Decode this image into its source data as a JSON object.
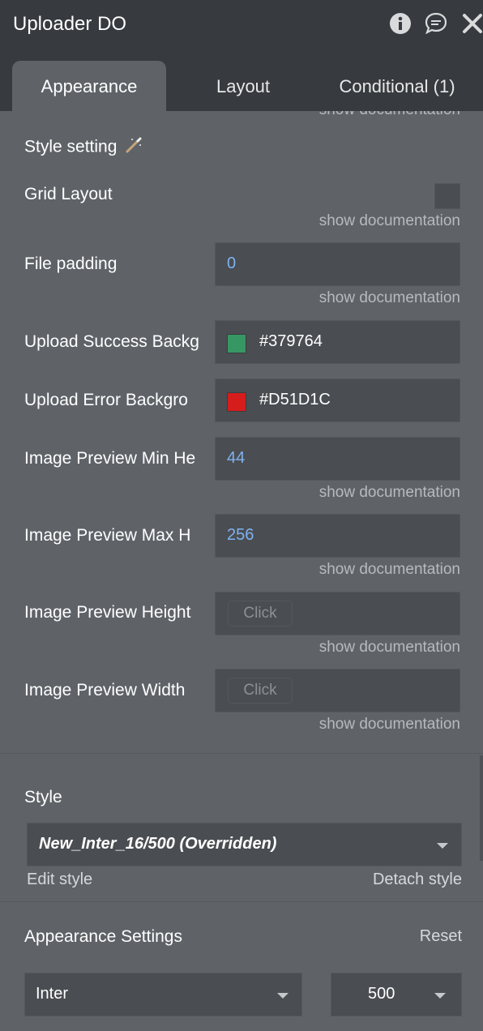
{
  "window": {
    "title": "Uploader DO"
  },
  "tabs": [
    {
      "label": "Appearance",
      "active": true
    },
    {
      "label": "Layout",
      "active": false
    },
    {
      "label": "Conditional (1)",
      "active": false
    }
  ],
  "doc_link": "show documentation",
  "style_setting": {
    "label": "Style setting",
    "icon": "magic-wand-icon"
  },
  "fields": {
    "grid_layout": {
      "label": "Grid Layout",
      "checked": false
    },
    "file_padding": {
      "label": "File padding",
      "value": "0"
    },
    "upload_success": {
      "label": "Upload Success Backg",
      "value": "#379764",
      "color": "#379764"
    },
    "upload_error": {
      "label": "Upload Error Backgro",
      "value": "#D51D1C",
      "color": "#D51D1C"
    },
    "preview_min_height": {
      "label": "Image Preview Min He",
      "value": "44"
    },
    "preview_max_height": {
      "label": "Image Preview Max H",
      "value": "256"
    },
    "preview_height": {
      "label": "Image Preview Height",
      "button": "Click"
    },
    "preview_width": {
      "label": "Image Preview Width",
      "button": "Click"
    }
  },
  "style": {
    "label": "Style",
    "selected": "New_Inter_16/500 (Overridden)",
    "edit": "Edit style",
    "detach": "Detach style"
  },
  "appearance_settings": {
    "label": "Appearance Settings",
    "reset": "Reset",
    "font": "Inter",
    "weight": "500"
  },
  "colors": {
    "panel_bg": "#5f6368",
    "header_bg": "#373a3e",
    "input_bg": "#4a4d51",
    "number_accent": "#7fb2f0"
  }
}
